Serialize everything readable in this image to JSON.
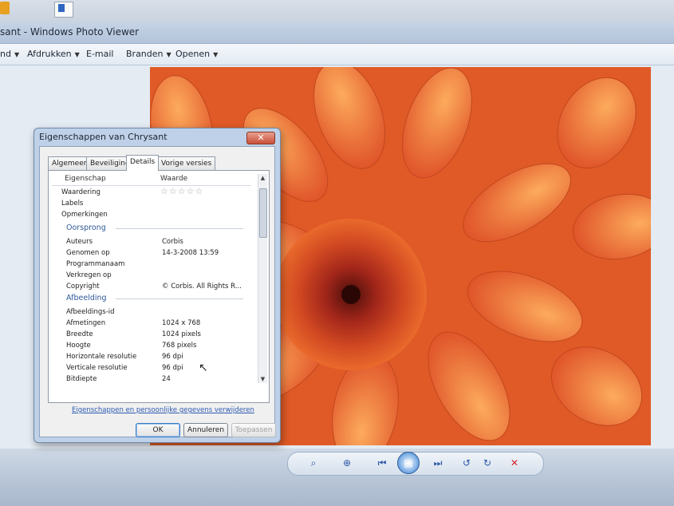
{
  "window": {
    "title": "sant - Windows Photo Viewer"
  },
  "menu": {
    "items": [
      {
        "label": "nd",
        "has_arrow": true
      },
      {
        "label": "Afdrukken",
        "has_arrow": true
      },
      {
        "label": "E-mail",
        "has_arrow": false
      },
      {
        "label": "Branden",
        "has_arrow": true
      },
      {
        "label": "Openen",
        "has_arrow": true
      }
    ]
  },
  "dialog": {
    "title": "Eigenschappen van Chrysant",
    "close_label": "✕",
    "tabs": [
      "Algemeen",
      "Beveiliging",
      "Details",
      "Vorige versies"
    ],
    "active_tab": "Details",
    "columns": {
      "property": "Eigenschap",
      "value": "Waarde"
    },
    "rows_top": [
      {
        "key": "Waardering",
        "value": ""
      },
      {
        "key": "Labels",
        "value": ""
      },
      {
        "key": "Opmerkingen",
        "value": ""
      }
    ],
    "rating_stars": "☆☆☆☆☆",
    "group_origin": "Oorsprong",
    "rows_origin": [
      {
        "key": "Auteurs",
        "value": "Corbis"
      },
      {
        "key": "Genomen op",
        "value": "14-3-2008 13:59"
      },
      {
        "key": "Programmanaam",
        "value": ""
      },
      {
        "key": "Verkregen op",
        "value": ""
      },
      {
        "key": "Copyright",
        "value": "© Corbis.  All Rights R..."
      }
    ],
    "group_image": "Afbeelding",
    "rows_image": [
      {
        "key": "Afbeeldings-id",
        "value": ""
      },
      {
        "key": "Afmetingen",
        "value": "1024 x 768"
      },
      {
        "key": "Breedte",
        "value": "1024 pixels"
      },
      {
        "key": "Hoogte",
        "value": "768 pixels"
      },
      {
        "key": "Horizontale resolutie",
        "value": "96 dpi"
      },
      {
        "key": "Verticale resolutie",
        "value": "96 dpi"
      },
      {
        "key": "Bitdiepte",
        "value": "24"
      }
    ],
    "link": "Eigenschappen en persoonlijke gegevens verwijderen",
    "buttons": {
      "ok": "OK",
      "cancel": "Annuleren",
      "apply": "Toepassen"
    }
  },
  "colors": {
    "accent": "#2f5a9a",
    "photo_orange": "#e8632a",
    "delete_red": "#d3242b"
  },
  "icons": {
    "zoom": "magnifier-icon",
    "fit": "fit-window-icon",
    "prev": "previous-icon",
    "slideshow": "slideshow-icon",
    "next": "next-icon",
    "rotate_ccw": "rotate-left-icon",
    "rotate_cw": "rotate-right-icon",
    "delete": "delete-icon"
  }
}
